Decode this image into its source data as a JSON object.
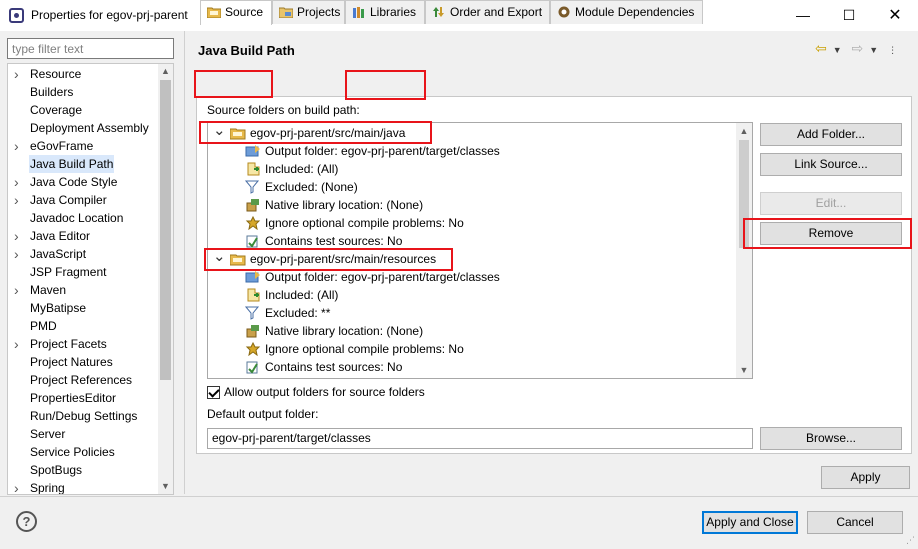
{
  "window": {
    "title": "Properties for egov-prj-parent",
    "minimize_glyph": "—",
    "maximize_glyph": "☐",
    "close_glyph": "✕"
  },
  "filter": {
    "placeholder": "type filter text",
    "value": ""
  },
  "tree": {
    "items": [
      {
        "label": "Resource",
        "expandable": true
      },
      {
        "label": "Builders",
        "expandable": false
      },
      {
        "label": "Coverage",
        "expandable": false
      },
      {
        "label": "Deployment Assembly",
        "expandable": false
      },
      {
        "label": "eGovFrame",
        "expandable": true
      },
      {
        "label": "Java Build Path",
        "expandable": false,
        "selected": true
      },
      {
        "label": "Java Code Style",
        "expandable": true
      },
      {
        "label": "Java Compiler",
        "expandable": true
      },
      {
        "label": "Javadoc Location",
        "expandable": false
      },
      {
        "label": "Java Editor",
        "expandable": true
      },
      {
        "label": "JavaScript",
        "expandable": true
      },
      {
        "label": "JSP Fragment",
        "expandable": false
      },
      {
        "label": "Maven",
        "expandable": true
      },
      {
        "label": "MyBatipse",
        "expandable": false
      },
      {
        "label": "PMD",
        "expandable": false
      },
      {
        "label": "Project Facets",
        "expandable": true
      },
      {
        "label": "Project Natures",
        "expandable": false
      },
      {
        "label": "Project References",
        "expandable": false
      },
      {
        "label": "PropertiesEditor",
        "expandable": false
      },
      {
        "label": "Run/Debug Settings",
        "expandable": false
      },
      {
        "label": "Server",
        "expandable": false
      },
      {
        "label": "Service Policies",
        "expandable": false
      },
      {
        "label": "SpotBugs",
        "expandable": false
      },
      {
        "label": "Spring",
        "expandable": true
      }
    ]
  },
  "page": {
    "title": "Java Build Path"
  },
  "tabs": [
    {
      "label": "Source",
      "active": true
    },
    {
      "label": "Projects"
    },
    {
      "label": "Libraries"
    },
    {
      "label": "Order and Export"
    },
    {
      "label": "Module Dependencies"
    }
  ],
  "source": {
    "section_label": "Source folders on build path:",
    "folders": [
      {
        "path": "egov-prj-parent/src/main/java",
        "attributes": [
          "Output folder: egov-prj-parent/target/classes",
          "Included: (All)",
          "Excluded: (None)",
          "Native library location: (None)",
          "Ignore optional compile problems: No",
          "Contains test sources: No"
        ]
      },
      {
        "path": "egov-prj-parent/src/main/resources",
        "attributes": [
          "Output folder: egov-prj-parent/target/classes",
          "Included: (All)",
          "Excluded: **",
          "Native library location: (None)",
          "Ignore optional compile problems: No",
          "Contains test sources: No"
        ]
      }
    ],
    "buttons": {
      "add_folder": "Add Folder...",
      "link_source": "Link Source...",
      "edit": "Edit...",
      "remove": "Remove"
    },
    "allow_output_label": "Allow output folders for source folders",
    "allow_output_checked": true,
    "default_output_label": "Default output folder:",
    "default_output_value": "egov-prj-parent/target/classes",
    "browse": "Browse..."
  },
  "footer": {
    "apply": "Apply",
    "apply_and_close": "Apply and Close",
    "cancel": "Cancel",
    "help_glyph": "?"
  },
  "colors": {
    "highlight": "#e8141a",
    "selection": "#d9e8fb",
    "accent": "#0078d7"
  }
}
